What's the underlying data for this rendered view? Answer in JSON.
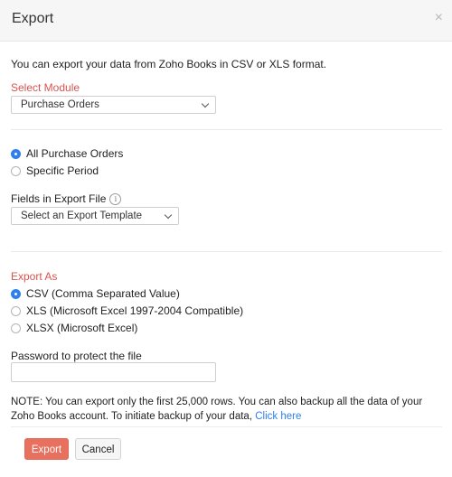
{
  "dialog": {
    "title": "Export",
    "close_glyph": "×",
    "intro": "You can export your data from Zoho Books in CSV or XLS format."
  },
  "module": {
    "label": "Select Module",
    "selected": "Purchase Orders"
  },
  "range": {
    "options": [
      {
        "label": "All Purchase Orders",
        "checked": true
      },
      {
        "label": "Specific Period",
        "checked": false
      }
    ]
  },
  "fields": {
    "label": "Fields in Export File",
    "info_glyph": "i",
    "template_placeholder": "Select an Export Template"
  },
  "export_as": {
    "label": "Export As",
    "options": [
      {
        "label": "CSV (Comma Separated Value)",
        "checked": true
      },
      {
        "label": "XLS (Microsoft Excel 1997-2004 Compatible)",
        "checked": false
      },
      {
        "label": "XLSX (Microsoft Excel)",
        "checked": false
      }
    ]
  },
  "password": {
    "label": "Password to protect the file",
    "value": ""
  },
  "note": {
    "text": "NOTE:  You can export only the first 25,000 rows. You can also backup all the data of your Zoho Books account. To initiate backup of your data, ",
    "link": "Click here"
  },
  "actions": {
    "export_label": "Export",
    "cancel_label": "Cancel"
  },
  "colors": {
    "accent_red": "#d9534f",
    "primary_button": "#e8705e",
    "link_blue": "#2f80ed"
  }
}
